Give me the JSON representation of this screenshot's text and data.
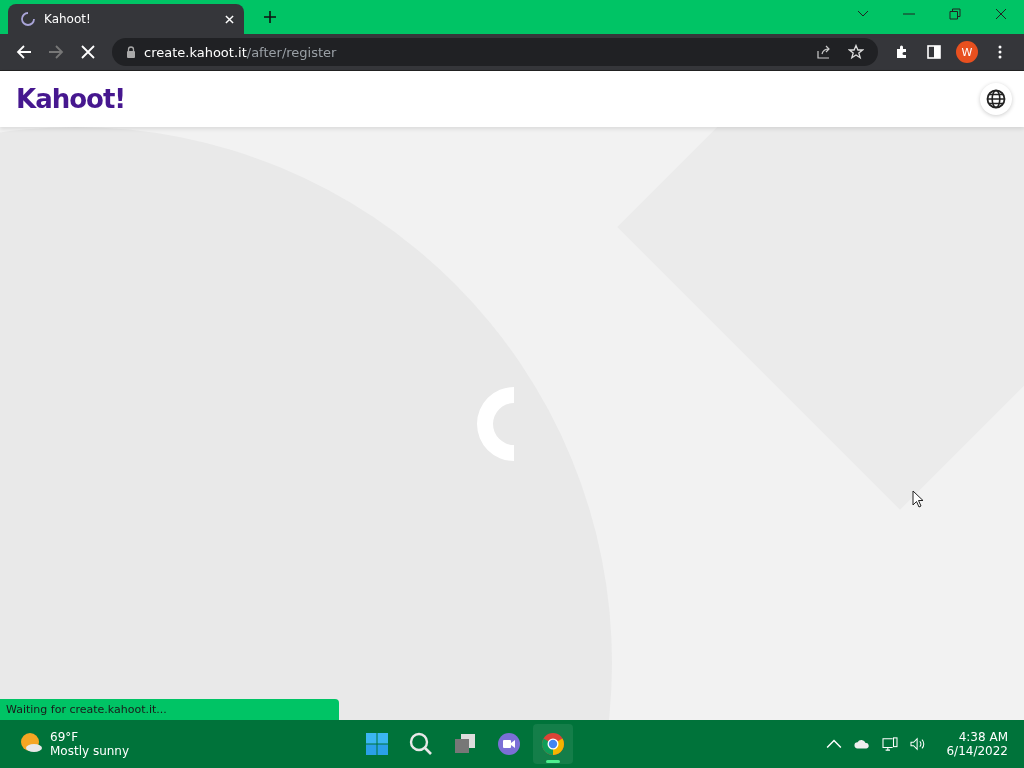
{
  "browser": {
    "tab": {
      "title": "Kahoot!",
      "loading": true
    },
    "address": {
      "host": "create.kahoot.it",
      "path": "/after/register"
    },
    "profile_initial": "W"
  },
  "page": {
    "logo": "Kahoot!",
    "loading": true
  },
  "status_bubble": "Waiting for create.kahoot.it...",
  "taskbar": {
    "weather": {
      "temperature": "69°F",
      "condition": "Mostly sunny"
    },
    "apps": [
      {
        "kind": "start",
        "selected": false
      },
      {
        "kind": "search",
        "selected": false
      },
      {
        "kind": "taskview",
        "selected": false
      },
      {
        "kind": "chat",
        "selected": false
      },
      {
        "kind": "chrome",
        "selected": true
      }
    ],
    "time": "4:38 AM",
    "date": "6/14/2022"
  }
}
